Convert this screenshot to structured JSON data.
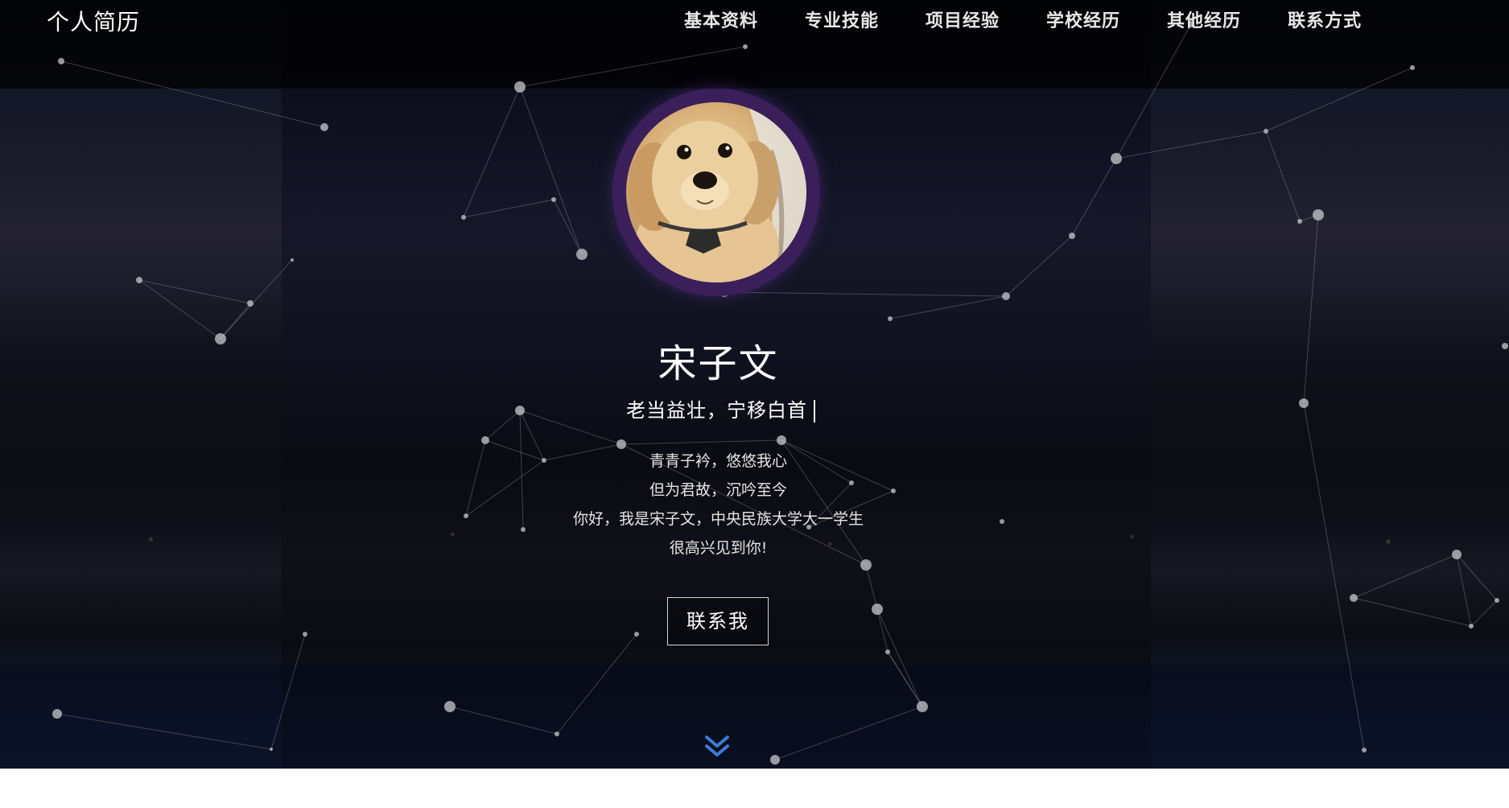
{
  "header": {
    "brand": "个人简历",
    "nav": [
      {
        "label": "基本资料"
      },
      {
        "label": "专业技能"
      },
      {
        "label": "项目经验"
      },
      {
        "label": "学校经历"
      },
      {
        "label": "其他经历"
      },
      {
        "label": "联系方式"
      }
    ]
  },
  "hero": {
    "avatar_icon": "puppy-avatar",
    "name": "宋子文",
    "motto": "老当益壮，宁移白首",
    "intro_lines": [
      "青青子衿，悠悠我心",
      "但为君故，沉吟至今",
      "你好，我是宋子文，中央民族大学大一学生",
      "很高兴见到你!"
    ],
    "contact_button": "联系我",
    "scroll_icon": "double-chevron-down-icon"
  },
  "colors": {
    "avatar_ring": "#3a1f5a",
    "scroll_icon": "#3a7bd5",
    "text": "#ffffff"
  }
}
